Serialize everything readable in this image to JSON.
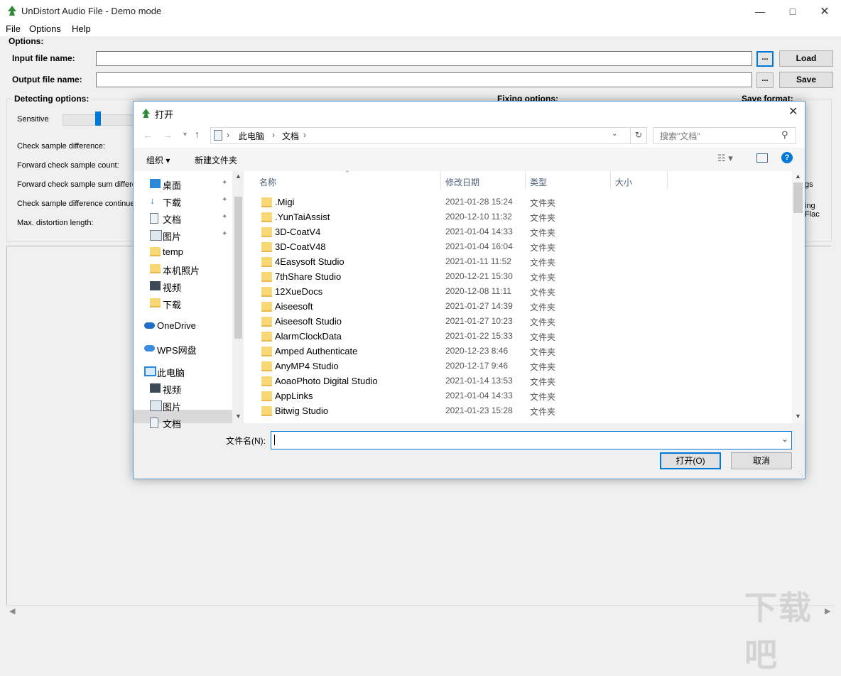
{
  "app": {
    "title": "UnDistort Audio File - Demo mode",
    "menu": [
      "File",
      "Options",
      "Help"
    ],
    "options_title": "Options:",
    "input_label": "Input file name:",
    "output_label": "Output file name:",
    "input_value": "",
    "output_value": "",
    "browse_label": "...",
    "load_label": "Load",
    "save_label": "Save",
    "detecting_title": "Detecting options:",
    "fixing_title": "Fixing options:",
    "save_format_title": "Save format:",
    "sensitive_label": "Sensitive",
    "params": [
      "Check sample difference:",
      "Forward check sample count:",
      "Forward check sample sum differe",
      "Check sample difference continue",
      "Max. distortion length:"
    ],
    "right_fragments": [
      "gs",
      "ing",
      "Flac"
    ]
  },
  "dialog": {
    "title": "打开",
    "breadcrumb": [
      "此电脑",
      "文档"
    ],
    "search_placeholder": "搜索\"文档\"",
    "toolbar": {
      "organize": "组织 ▾",
      "new_folder": "新建文件夹"
    },
    "nav": [
      {
        "label": "桌面",
        "icon": "desktop-icon",
        "pinned": true
      },
      {
        "label": "下载",
        "icon": "download-icon",
        "pinned": true
      },
      {
        "label": "文档",
        "icon": "document-icon",
        "pinned": true
      },
      {
        "label": "图片",
        "icon": "picture-icon",
        "pinned": true
      },
      {
        "label": "temp",
        "icon": "folder-icon",
        "pinned": false
      },
      {
        "label": "本机照片",
        "icon": "folder-icon",
        "pinned": false
      },
      {
        "label": "视频",
        "icon": "video-icon",
        "pinned": false
      },
      {
        "label": "下载",
        "icon": "folder-icon",
        "pinned": false
      },
      {
        "label": "OneDrive",
        "icon": "onedrive-icon",
        "pinned": false
      },
      {
        "label": "WPS网盘",
        "icon": "cloud-icon",
        "pinned": false
      },
      {
        "label": "此电脑",
        "icon": "computer-icon",
        "pinned": false
      },
      {
        "label": "视频",
        "icon": "video-icon",
        "pinned": false
      },
      {
        "label": "图片",
        "icon": "picture-icon",
        "pinned": false
      },
      {
        "label": "文档",
        "icon": "document-icon",
        "pinned": false
      }
    ],
    "columns": [
      "名称",
      "修改日期",
      "类型",
      "大小"
    ],
    "files": [
      {
        "name": ".Migi",
        "date": "2021-01-28 15:24",
        "type": "文件夹"
      },
      {
        "name": ".YunTaiAssist",
        "date": "2020-12-10 11:32",
        "type": "文件夹"
      },
      {
        "name": "3D-CoatV4",
        "date": "2021-01-04 14:33",
        "type": "文件夹"
      },
      {
        "name": "3D-CoatV48",
        "date": "2021-01-04 16:04",
        "type": "文件夹"
      },
      {
        "name": "4Easysoft Studio",
        "date": "2021-01-11 11:52",
        "type": "文件夹"
      },
      {
        "name": "7thShare Studio",
        "date": "2020-12-21 15:30",
        "type": "文件夹"
      },
      {
        "name": "12XueDocs",
        "date": "2020-12-08 11:11",
        "type": "文件夹"
      },
      {
        "name": "Aiseesoft",
        "date": "2021-01-27 14:39",
        "type": "文件夹"
      },
      {
        "name": "Aiseesoft Studio",
        "date": "2021-01-27 10:23",
        "type": "文件夹"
      },
      {
        "name": "AlarmClockData",
        "date": "2021-01-22 15:33",
        "type": "文件夹"
      },
      {
        "name": "Amped Authenticate",
        "date": "2020-12-23 8:46",
        "type": "文件夹"
      },
      {
        "name": "AnyMP4 Studio",
        "date": "2020-12-17 9:46",
        "type": "文件夹"
      },
      {
        "name": "AoaoPhoto Digital Studio",
        "date": "2021-01-14 13:53",
        "type": "文件夹"
      },
      {
        "name": "AppLinks",
        "date": "2021-01-04 14:33",
        "type": "文件夹"
      },
      {
        "name": "Bitwig Studio",
        "date": "2021-01-23 15:28",
        "type": "文件夹"
      }
    ],
    "filename_label": "文件名(N):",
    "filename_value": "",
    "open_label": "打开(O)",
    "cancel_label": "取消"
  },
  "colors": {
    "accent": "#0078d7",
    "folder": "#f8d775",
    "selected_nav": "#d9d9d9"
  }
}
